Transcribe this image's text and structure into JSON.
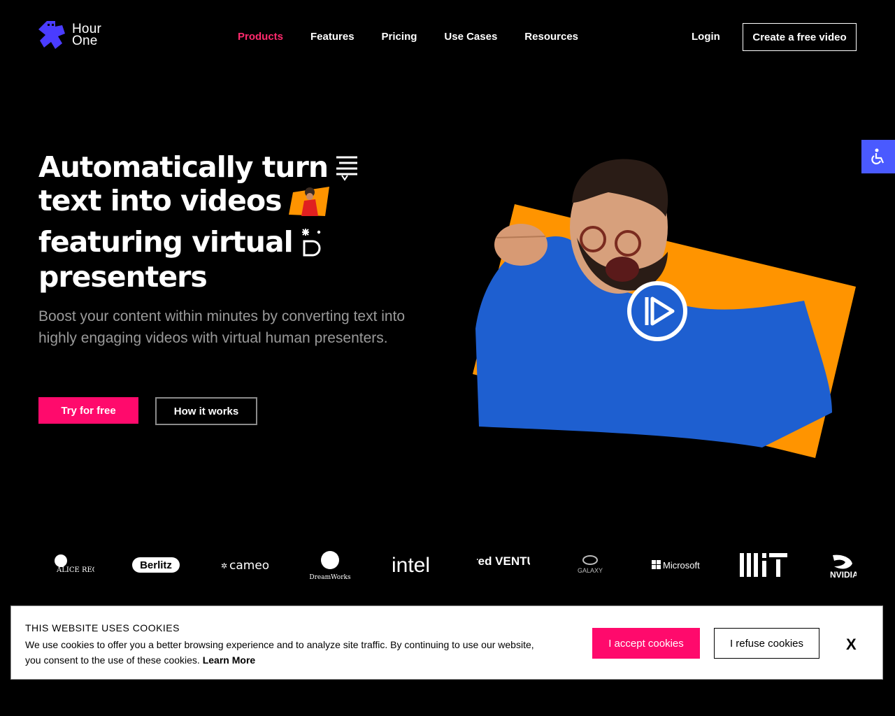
{
  "brand": {
    "line1": "Hour",
    "line2": "One",
    "accent": "#4a3cff"
  },
  "nav": {
    "items": [
      {
        "label": "Products",
        "active": true
      },
      {
        "label": "Features"
      },
      {
        "label": "Pricing"
      },
      {
        "label": "Use Cases"
      },
      {
        "label": "Resources"
      }
    ],
    "login": "Login",
    "cta": "Create a free video"
  },
  "hero": {
    "headline": [
      "Automatically turn",
      "text into videos",
      "featuring virtual",
      "presenters"
    ],
    "subtext": "Boost your content within minutes by converting text into highly engaging videos with virtual human presenters.",
    "primary_btn": "Try for free",
    "secondary_btn": "How it works",
    "accent_pink": "#ff0a6c",
    "accent_orange": "#ff9400"
  },
  "partners": [
    "ALICE RECEPTIONIST",
    "Berlitz",
    "cameo",
    "DreamWorks",
    "intel",
    "Kindred VENTURES",
    "GALAXY",
    "Microsoft",
    "MIT",
    "NVIDIA"
  ],
  "cookie": {
    "title": "THIS WEBSITE USES COOKIES",
    "text": "We use cookies to offer you a better browsing experience and to analyze site traffic. By continuing to use our website, you consent to the use of these cookies.",
    "learn_more": "Learn More",
    "accept": "I accept cookies",
    "refuse": "I refuse cookies",
    "close": "X"
  },
  "icons": {
    "accessibility": "wheelchair-icon",
    "play": "play-icon"
  }
}
